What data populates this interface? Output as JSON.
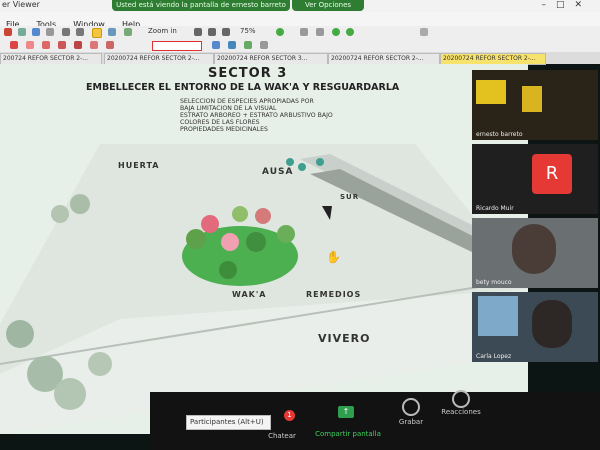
{
  "window": {
    "title": "er Viewer",
    "share_banner": "Usted está viendo la pantalla de ernesto barreto",
    "share_options": "Ver Opciones"
  },
  "menu": [
    "File",
    "Tools",
    "Window",
    "Help"
  ],
  "toolbar": {
    "zoom_label": "Zoom in",
    "zoom_value": "75%"
  },
  "tabs": [
    {
      "label": "200724 REFOR SECTOR 2-...",
      "active": false
    },
    {
      "label": "20200724 REFOR SECTOR 2-...",
      "active": false
    },
    {
      "label": "20200724 REFOR SECTOR 3...",
      "active": false
    },
    {
      "label": "20200724 REFOR SECTOR 2-...",
      "active": false
    },
    {
      "label": "20200724 REFOR SECTOR 2-...",
      "active": true
    }
  ],
  "slide": {
    "title": "SECTOR 3",
    "subtitle": "EMBELLECER EL ENTORNO DE LA WAK'A Y RESGUARDARLA",
    "bullets": [
      "SELECCION DE ESPECIES APROPIADAS POR",
      "BAJA LIMITACION DE LA VISUAL",
      "ESTRATO ARBOREO + ESTRATO ARBUSTIVO BAJO",
      "COLORES DE LAS FLORES",
      "PROPIEDADES MEDICINALES"
    ],
    "labels": {
      "huerta": "HUERTA",
      "ausa": "AUSA",
      "sur": "SUR",
      "waka": "WAK'A",
      "remedios": "REMEDIOS",
      "vivero": "VIVERO"
    }
  },
  "participants": [
    {
      "name": "ernesto barreto",
      "type": "video"
    },
    {
      "name": "Ricardo Muir",
      "type": "avatar",
      "initial": "R"
    },
    {
      "name": "bety mouco",
      "type": "video"
    },
    {
      "name": "Carla Lopez",
      "type": "video"
    }
  ],
  "bottombar": {
    "participants_tooltip": "Participantes (Alt+U)",
    "chat_label": "Chatear",
    "chat_badge": "1",
    "share_label": "Compartir pantalla",
    "record_label": "Grabar",
    "reactions_label": "Reacciones"
  },
  "colors": {
    "share_green": "#2f7d32",
    "slide_bg": "#e7efe9",
    "avatar_red": "#e53935",
    "active_tab": "#f7e26b"
  }
}
